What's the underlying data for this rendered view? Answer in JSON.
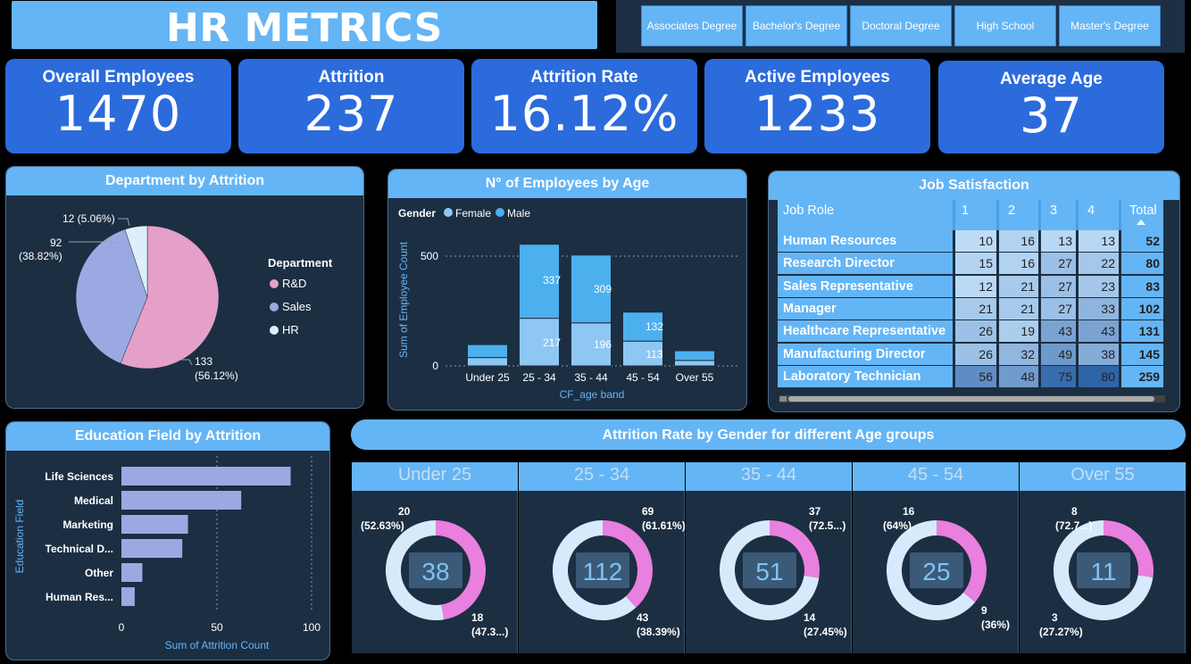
{
  "title": "HR METRICS",
  "slicer": {
    "items": [
      "Associates Degree",
      "Bachelor's Degree",
      "Doctoral Degree",
      "High School",
      "Master's Degree"
    ]
  },
  "kpis": [
    {
      "label": "Overall Employees",
      "value": "1470"
    },
    {
      "label": "Attrition",
      "value": "237"
    },
    {
      "label": "Attrition Rate",
      "value": "16.12%"
    },
    {
      "label": "Active Employees",
      "value": "1233"
    },
    {
      "label": "Average Age",
      "value": "37"
    }
  ],
  "colors": {
    "rnd": "#e4a0c8",
    "sales": "#9ba9e2",
    "hr": "#dfeefb",
    "female": "#8fc7f4",
    "male": "#4cb0ef",
    "bar": "#9ba9e2",
    "donut_male": "#d7eafb",
    "donut_female": "#e97fde"
  },
  "dept_chart": {
    "title": "Department by Attrition",
    "legend_title": "Department",
    "legend": [
      "R&D",
      "Sales",
      "HR"
    ],
    "labels": {
      "hr": "12 (5.06%)",
      "sales_count": "92",
      "sales_pct": "(38.82%)",
      "rnd_count": "133",
      "rnd_pct": "(56.12%)"
    }
  },
  "age_chart": {
    "title": "N° of Employees by Age",
    "legend_title": "Gender",
    "legend": [
      "Female",
      "Male"
    ],
    "ylabel": "Sum of Employee Count",
    "xlabel": "CF_age band",
    "ticks": [
      "0",
      "500"
    ],
    "bar_labels": {
      "b25_34": {
        "female": "217",
        "male": "337"
      },
      "b35_44": {
        "female": "196",
        "male": "309"
      },
      "b45_54": {
        "female": "113",
        "male": "132"
      }
    }
  },
  "job_table": {
    "title": "Job Satisfaction",
    "headers": [
      "Job Role",
      "1",
      "2",
      "3",
      "4",
      "Total"
    ],
    "rows": [
      {
        "role": "Human Resources",
        "v": [
          "10",
          "16",
          "13",
          "13"
        ],
        "total": "52"
      },
      {
        "role": "Research Director",
        "v": [
          "15",
          "16",
          "27",
          "22"
        ],
        "total": "80"
      },
      {
        "role": "Sales Representative",
        "v": [
          "12",
          "21",
          "27",
          "23"
        ],
        "total": "83"
      },
      {
        "role": "Manager",
        "v": [
          "21",
          "21",
          "27",
          "33"
        ],
        "total": "102"
      },
      {
        "role": "Healthcare Representative",
        "v": [
          "26",
          "19",
          "43",
          "43"
        ],
        "total": "131"
      },
      {
        "role": "Manufacturing Director",
        "v": [
          "26",
          "32",
          "49",
          "38"
        ],
        "total": "145"
      },
      {
        "role": "Laboratory Technician",
        "v": [
          "56",
          "48",
          "75",
          "80"
        ],
        "total": "259"
      }
    ]
  },
  "edu_chart": {
    "title": "Education Field by Attrition",
    "ylabel": "Education Field",
    "xlabel": "Sum of Attrition Count",
    "ticks": [
      "0",
      "50",
      "100"
    ]
  },
  "gender_title": "Attrition Rate by Gender for different Age groups",
  "age_groups": [
    {
      "name": "Under 25",
      "total": "38",
      "male_label": "20",
      "male_pct": "(52.63%)",
      "female_label": "18",
      "female_pct": "(47.3...)"
    },
    {
      "name": "25 - 34",
      "total": "112",
      "male_label": "69",
      "male_pct": "(61.61%)",
      "female_label": "43",
      "female_pct": "(38.39%)"
    },
    {
      "name": "35 - 44",
      "total": "51",
      "male_label": "37",
      "male_pct": "(72.5...)",
      "female_label": "14",
      "female_pct": "(27.45%)"
    },
    {
      "name": "45 - 54",
      "total": "25",
      "male_label": "16",
      "male_pct": "(64%)",
      "female_label": "9",
      "female_pct": "(36%)"
    },
    {
      "name": "Over 55",
      "total": "11",
      "male_label": "8",
      "male_pct": "(72.7...)",
      "female_label": "3",
      "female_pct": "(27.27%)"
    }
  ],
  "chart_data": [
    {
      "type": "pie",
      "title": "Department by Attrition",
      "categories": [
        "R&D",
        "Sales",
        "HR"
      ],
      "values": [
        133,
        92,
        12
      ]
    },
    {
      "type": "bar",
      "title": "N° of Employees by Age",
      "stacked": true,
      "categories": [
        "Under 25",
        "25 - 34",
        "35 - 44",
        "45 - 54",
        "Over 55"
      ],
      "series": [
        {
          "name": "Female",
          "values": [
            38,
            217,
            196,
            113,
            25
          ]
        },
        {
          "name": "Male",
          "values": [
            59,
            337,
            309,
            132,
            44
          ]
        }
      ],
      "xlabel": "CF_age band",
      "ylabel": "Sum of Employee Count",
      "ylim": [
        0,
        620
      ]
    },
    {
      "type": "bar",
      "orientation": "horizontal",
      "title": "Education Field by Attrition",
      "categories": [
        "Life Sciences",
        "Medical",
        "Marketing",
        "Technical D...",
        "Other",
        "Human Res..."
      ],
      "values": [
        89,
        63,
        35,
        32,
        11,
        7
      ],
      "xlabel": "Sum of Attrition Count",
      "ylabel": "Education Field",
      "xlim": [
        0,
        100
      ]
    },
    {
      "type": "pie",
      "title": "Attrition Rate by Gender for different Age groups",
      "categories": [
        "Under 25",
        "25 - 34",
        "35 - 44",
        "45 - 54",
        "Over 55"
      ],
      "series": [
        {
          "values": [
            20,
            69,
            37,
            16,
            8
          ]
        },
        {
          "values": [
            18,
            43,
            14,
            9,
            3
          ]
        }
      ]
    }
  ]
}
